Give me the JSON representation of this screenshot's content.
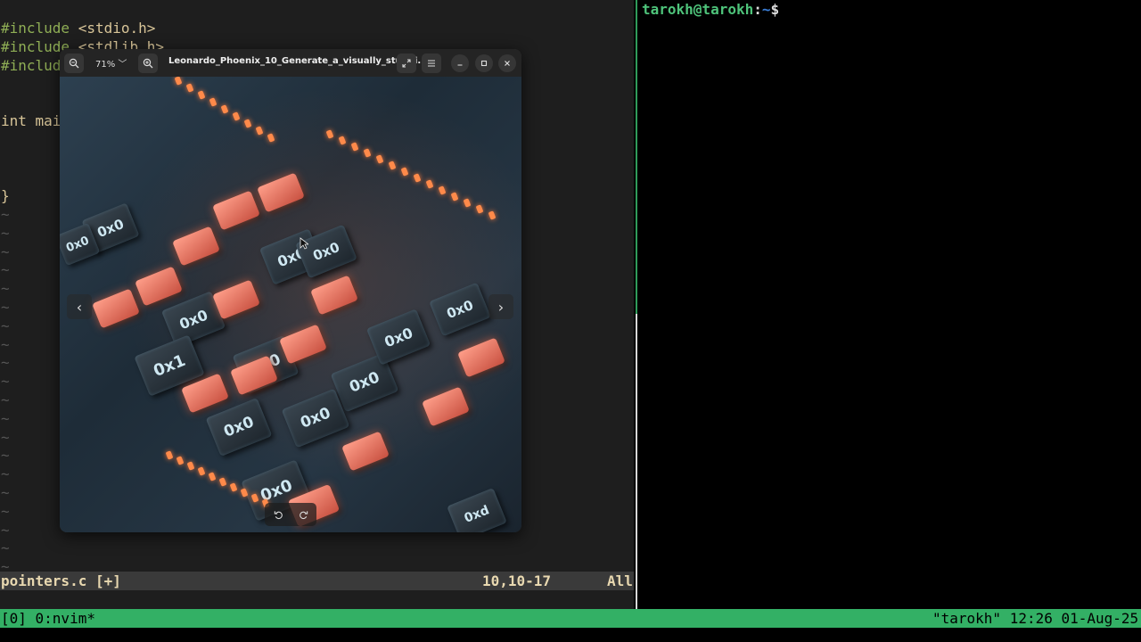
{
  "editor": {
    "lines": [
      {
        "pp": "#include",
        "rest": " <stdio.h>"
      },
      {
        "pp": "#include",
        "rest": " <stdlib.h>"
      },
      {
        "pp": "#includ",
        "rest": ""
      },
      {
        "text": ""
      },
      {
        "kw": "int",
        "rest": " mai"
      },
      {
        "text": ""
      },
      {
        "text": ""
      },
      {
        "text": ""
      },
      {
        "text": ""
      },
      {
        "text": "}"
      }
    ],
    "tilde": "~",
    "status": {
      "filename": "pointers.c [+]",
      "position": "10,10-17",
      "scroll": "All"
    }
  },
  "terminal": {
    "user": "tarokh@tarokh",
    "sep": ":",
    "path": "~",
    "sign": "$"
  },
  "tmux": {
    "left": "[0] 0:nvim*",
    "right": "\"tarokh\" 12:26 01-Aug-25"
  },
  "viewer": {
    "zoom": "71%",
    "title": "Leonardo_Phoenix_10_Generate_a_visually_stunni...",
    "chips": [
      {
        "label": "0x0",
        "type": "dark"
      },
      {
        "label": "0x0",
        "type": "dark"
      },
      {
        "label": "0x0",
        "type": "dark"
      },
      {
        "label": "0x0",
        "type": "dark"
      },
      {
        "label": "0x1",
        "type": "dark"
      },
      {
        "label": "0x0",
        "type": "dark"
      },
      {
        "label": "0x0",
        "type": "dark"
      },
      {
        "label": "0x0",
        "type": "dark"
      },
      {
        "label": "0x0",
        "type": "dark"
      },
      {
        "label": "0x0",
        "type": "dark"
      },
      {
        "label": "0x0",
        "type": "dark"
      },
      {
        "label": "0x0",
        "type": "dark"
      },
      {
        "label": "0x0",
        "type": "dark"
      },
      {
        "label": "0xd",
        "type": "dark"
      },
      {
        "label": "",
        "type": "red"
      },
      {
        "label": "",
        "type": "red"
      },
      {
        "label": "",
        "type": "red"
      },
      {
        "label": "",
        "type": "red"
      },
      {
        "label": "",
        "type": "red"
      },
      {
        "label": "",
        "type": "red"
      },
      {
        "label": "",
        "type": "red"
      },
      {
        "label": "",
        "type": "red"
      },
      {
        "label": "",
        "type": "red"
      },
      {
        "label": "",
        "type": "red"
      },
      {
        "label": "",
        "type": "red"
      },
      {
        "label": "",
        "type": "red"
      },
      {
        "label": "",
        "type": "red"
      },
      {
        "label": "",
        "type": "red"
      }
    ]
  },
  "colors": {
    "tmux_bar": "#33b065",
    "prompt_user": "#4ec37a",
    "prompt_path": "#3a7ed8",
    "preprocessor": "#8fae55"
  }
}
